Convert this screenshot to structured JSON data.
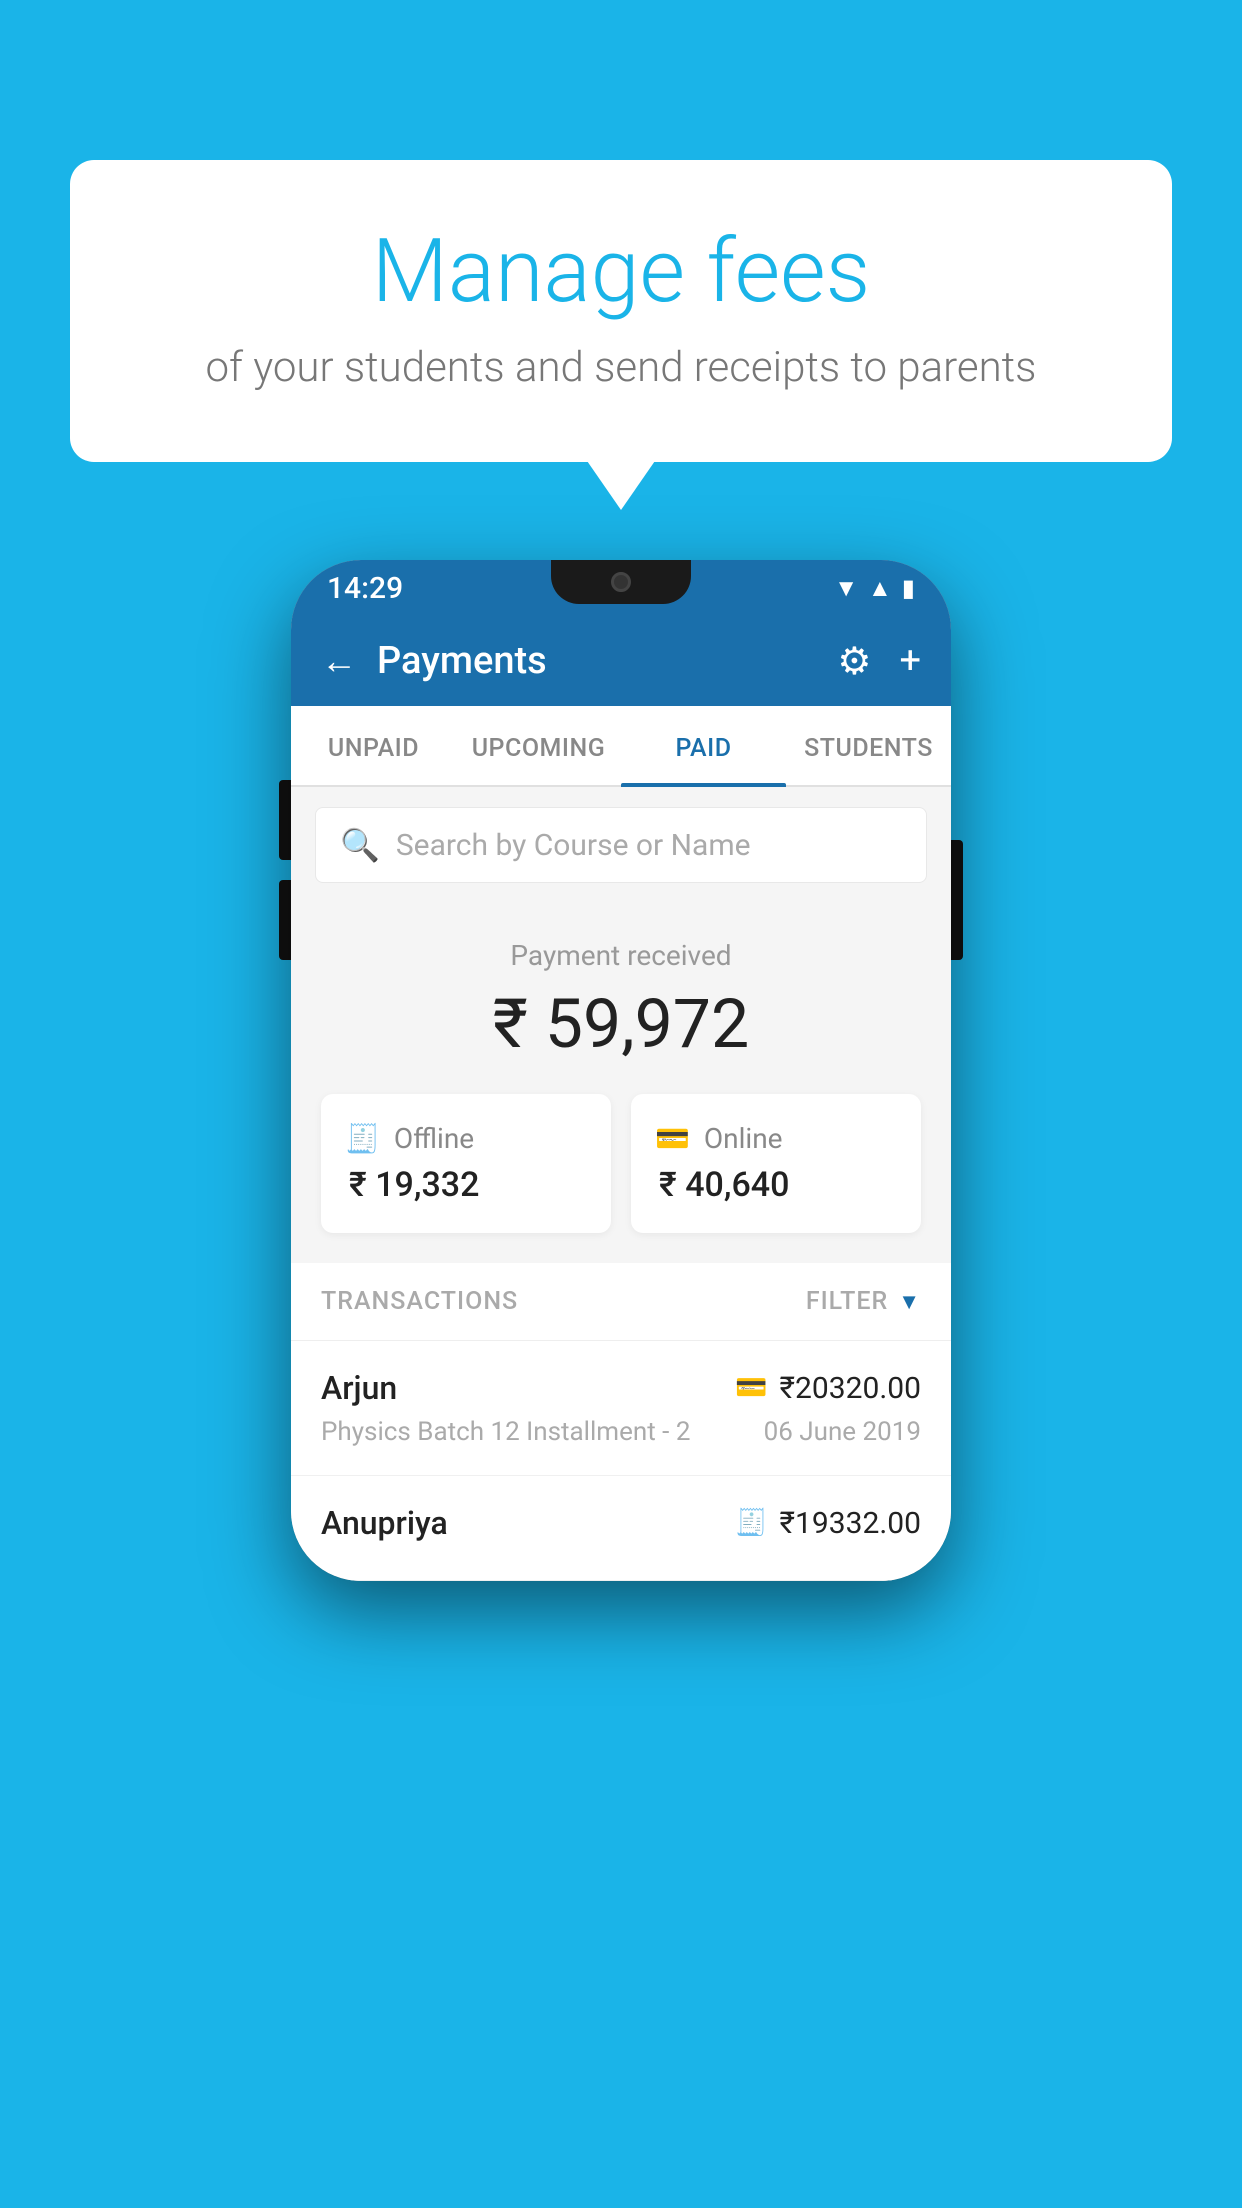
{
  "page": {
    "background_color": "#1ab4e8"
  },
  "speech_bubble": {
    "title": "Manage fees",
    "subtitle": "of your students and send receipts to parents"
  },
  "phone": {
    "status_bar": {
      "time": "14:29",
      "icons": "▲ ◀ ▮"
    },
    "header": {
      "title": "Payments",
      "back_label": "←",
      "gear_label": "⚙",
      "plus_label": "+"
    },
    "tabs": [
      {
        "label": "UNPAID",
        "active": false
      },
      {
        "label": "UPCOMING",
        "active": false
      },
      {
        "label": "PAID",
        "active": true
      },
      {
        "label": "STUDENTS",
        "active": false
      }
    ],
    "search": {
      "placeholder": "Search by Course or Name"
    },
    "payment_summary": {
      "label": "Payment received",
      "total": "₹ 59,972",
      "offline_label": "Offline",
      "offline_amount": "₹ 19,332",
      "online_label": "Online",
      "online_amount": "₹ 40,640"
    },
    "transactions": {
      "header_label": "TRANSACTIONS",
      "filter_label": "FILTER",
      "rows": [
        {
          "name": "Arjun",
          "course": "Physics Batch 12 Installment - 2",
          "amount": "₹20320.00",
          "date": "06 June 2019",
          "icon": "card"
        },
        {
          "name": "Anupriya",
          "course": "",
          "amount": "₹19332.00",
          "date": "",
          "icon": "cash"
        }
      ]
    }
  }
}
